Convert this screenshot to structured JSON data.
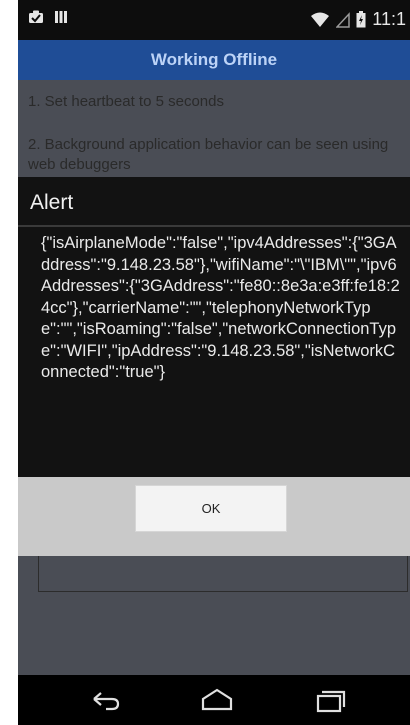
{
  "status": {
    "time": "11:1",
    "icons": [
      "notification-icon",
      "storage-icon",
      "wifi-icon",
      "signal-icon",
      "battery-icon"
    ]
  },
  "app": {
    "title": "Working Offline",
    "items": [
      "1. Set heartbeat to 5 seconds",
      "2. Background application behavior can be seen using web debuggers"
    ]
  },
  "dialog": {
    "title": "Alert",
    "message": "{\"isAirplaneMode\":\"false\",\"ipv4Addresses\":{\"3GAddress\":\"9.148.23.58\"},\"wifiName\":\"\\\"IBM\\\"\",\"ipv6Addresses\":{\"3GAddress\":\"fe80::8e3a:e3ff:fe18:24cc\"},\"carrierName\":\"\",\"telephonyNetworkType\":\"\",\"isRoaming\":\"false\",\"networkConnectionType\":\"WIFI\",\"ipAddress\":\"9.148.23.58\",\"isNetworkConnected\":\"true\"}",
    "ok_label": "OK"
  },
  "nav": {
    "icons": [
      "back-icon",
      "home-icon",
      "recent-apps-icon"
    ]
  },
  "colors": {
    "titlebar": "#1f4d96",
    "title_text": "#bcd3f7",
    "dim_background": "#4a4d55",
    "dialog_background": "#121212",
    "button_bar": "#c9c9c9"
  }
}
